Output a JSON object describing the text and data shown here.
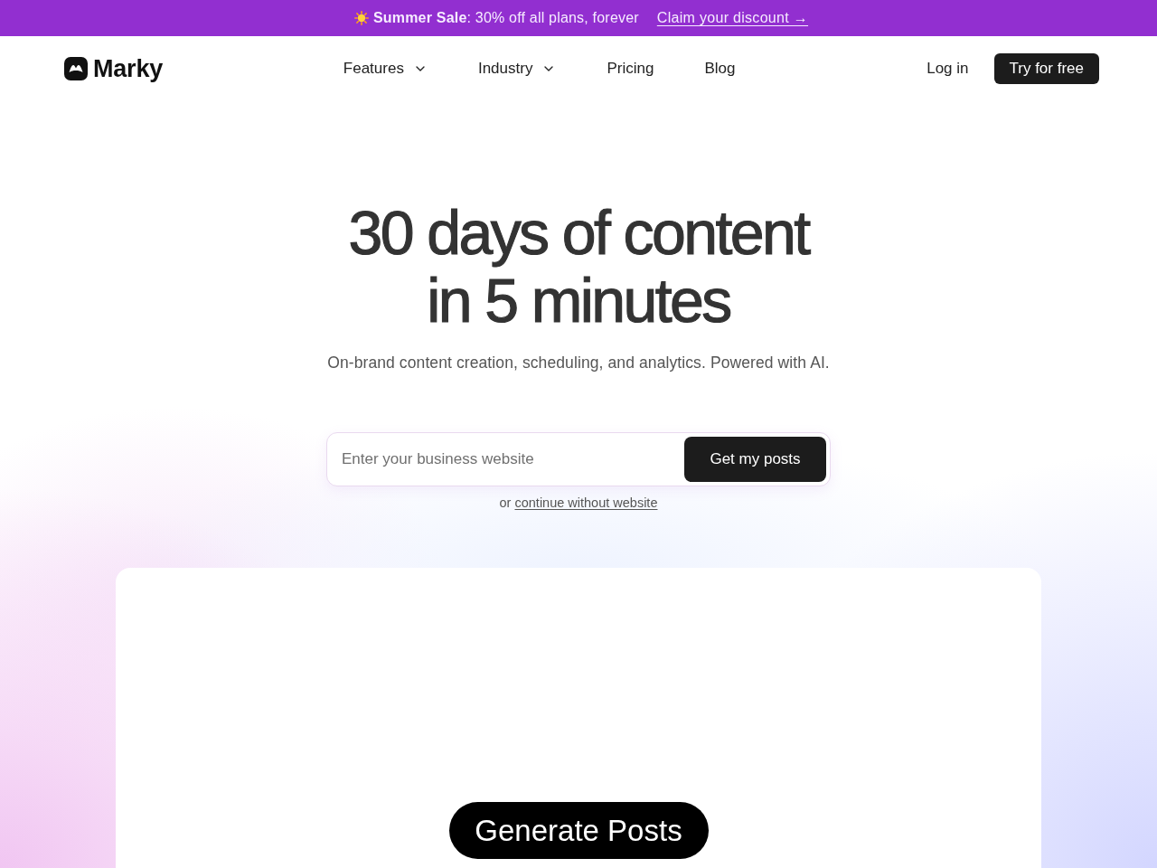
{
  "banner": {
    "text": "**Summer Sale**: 30% off all plans, forever",
    "link": "Claim your discount →"
  },
  "header": {
    "brand": "Marky",
    "nav": [
      {
        "label": "Features",
        "kind": "dropdown"
      },
      {
        "label": "Industry",
        "kind": "dropdown"
      },
      {
        "label": "Pricing",
        "kind": "link"
      },
      {
        "label": "Blog",
        "kind": "link"
      }
    ],
    "login": "Log in",
    "cta": "Try for free"
  },
  "hero": {
    "title_lines": [
      "30 days of content",
      "in 5 minutes"
    ],
    "subtitle": "On-brand content creation, scheduling, and analytics. Powered with AI.",
    "form": {
      "placeholder": "Enter your business website",
      "button": "Get my posts"
    },
    "alternative": {
      "prefix": "or",
      "link": "continue without website"
    }
  },
  "preview": {
    "button": "Generate Posts"
  }
}
